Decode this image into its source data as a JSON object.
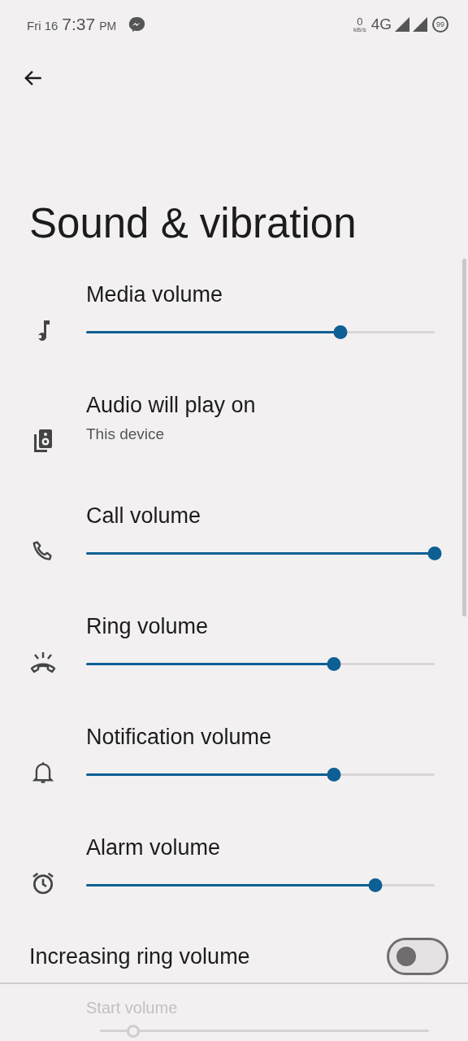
{
  "status_bar": {
    "date": "Fri 16",
    "time": "7:37",
    "ampm": "PM",
    "speed_value": "0",
    "speed_unit": "kB/s",
    "network": "4G",
    "battery": "99"
  },
  "title": "Sound & vibration",
  "items": [
    {
      "kind": "slider",
      "label": "Media volume",
      "level": 0.73,
      "disabled": false
    },
    {
      "kind": "info",
      "label": "Audio will play on",
      "summary": "This device"
    },
    {
      "kind": "slider",
      "label": "Call volume",
      "level": 1.0,
      "disabled": false
    },
    {
      "kind": "slider",
      "label": "Ring volume",
      "level": 0.71,
      "disabled": false
    },
    {
      "kind": "slider",
      "label": "Notification volume",
      "level": 0.71,
      "disabled": false
    },
    {
      "kind": "slider",
      "label": "Alarm volume",
      "level": 0.83,
      "disabled": false
    },
    {
      "kind": "switch",
      "label": "Increasing ring volume",
      "on": false
    },
    {
      "kind": "slider",
      "label": "Start volume",
      "level": 0.1,
      "disabled": true
    }
  ]
}
